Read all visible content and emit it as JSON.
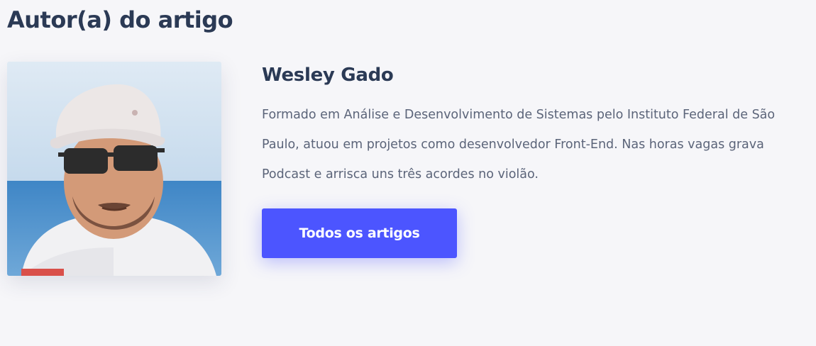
{
  "section": {
    "title": "Autor(a) do artigo"
  },
  "author": {
    "name": "Wesley Gado",
    "bio": "Formado em Análise e Desenvolvimento de Sistemas pelo Instituto Federal de São Paulo, atuou em projetos como desenvolvedor Front-End. Nas horas vagas grava Podcast e arrisca uns três acordes no violão.",
    "photo_alt": "Wesley Gado",
    "button_label": "Todos os artigos"
  },
  "colors": {
    "background": "#f6f6f9",
    "heading": "#2b3a55",
    "body_text": "#5b6479",
    "button": "#4c55ff",
    "button_text": "#ffffff"
  }
}
